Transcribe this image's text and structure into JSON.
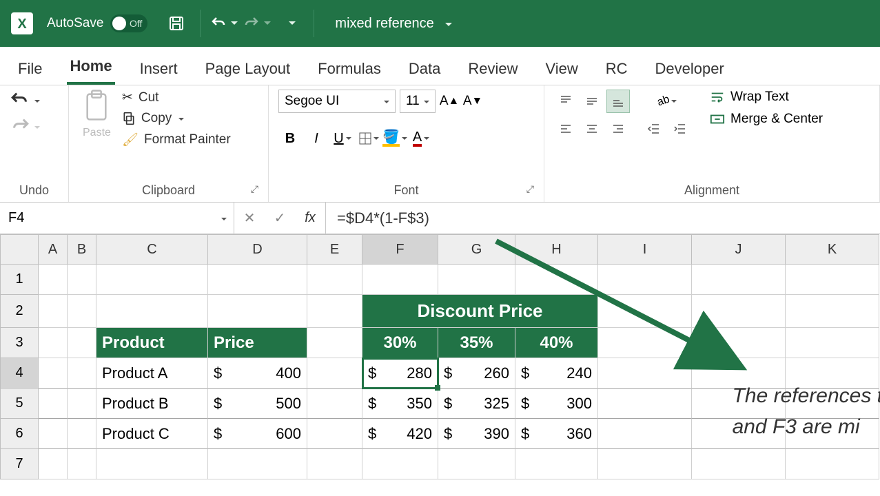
{
  "title": {
    "autosave": "AutoSave",
    "autosave_state": "Off",
    "doc": "mixed reference"
  },
  "tabs": [
    "File",
    "Home",
    "Insert",
    "Page Layout",
    "Formulas",
    "Data",
    "Review",
    "View",
    "RC",
    "Developer"
  ],
  "active_tab": "Home",
  "ribbon": {
    "undo_label": "Undo",
    "clipboard": {
      "paste": "Paste",
      "cut": "Cut",
      "copy": "Copy",
      "fmtpaint": "Format Painter",
      "label": "Clipboard"
    },
    "font": {
      "name": "Segoe UI",
      "size": "11",
      "label": "Font"
    },
    "alignment": {
      "wrap": "Wrap Text",
      "merge": "Merge & Center",
      "label": "Alignment"
    }
  },
  "namebox": "F4",
  "formula": "=$D4*(1-F$3)",
  "cols": [
    "A",
    "B",
    "C",
    "D",
    "E",
    "F",
    "G",
    "H",
    "I",
    "J",
    "K"
  ],
  "rows": [
    "1",
    "2",
    "3",
    "4",
    "5",
    "6",
    "7"
  ],
  "data": {
    "discount_title": "Discount Price",
    "h_product": "Product",
    "h_price": "Price",
    "pct_f": "30%",
    "pct_g": "35%",
    "pct_h": "40%",
    "p1": "Product A",
    "p2": "Product B",
    "p3": "Product C",
    "cur": "$",
    "d4": "400",
    "d5": "500",
    "d6": "600",
    "f4": "280",
    "g4": "260",
    "h4": "240",
    "f5": "350",
    "g5": "325",
    "h5": "300",
    "f6": "420",
    "g6": "390",
    "h6": "360"
  },
  "annotation": {
    "l1": "The references t",
    "l2": "and F3 are mi"
  }
}
